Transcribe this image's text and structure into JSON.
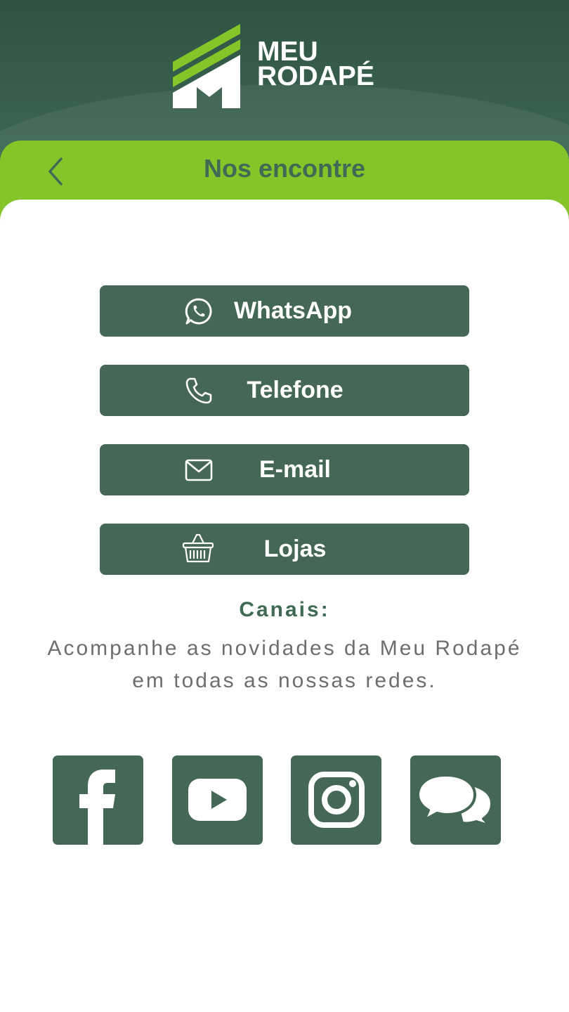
{
  "brand": {
    "line1": "MEU",
    "line2": "RODAPÉ"
  },
  "header": {
    "title": "Nos encontre"
  },
  "contact_buttons": [
    {
      "label": "WhatsApp",
      "icon": "whatsapp-icon"
    },
    {
      "label": "Telefone",
      "icon": "phone-icon"
    },
    {
      "label": "E-mail",
      "icon": "mail-icon"
    },
    {
      "label": "Lojas",
      "icon": "basket-icon"
    }
  ],
  "channels": {
    "heading": "Canais:",
    "description": "Acompanhe as novidades da Meu Rodapé em todas as nossas redes."
  },
  "social": [
    {
      "icon": "facebook-icon"
    },
    {
      "icon": "youtube-icon"
    },
    {
      "icon": "instagram-icon"
    },
    {
      "icon": "chat-bubbles-icon"
    }
  ],
  "colors": {
    "header_dark": "#2f5343",
    "accent_green": "#84c62a",
    "button_green": "#456755",
    "title_green": "#3f6b55",
    "text_gray": "#6e6e6e"
  }
}
